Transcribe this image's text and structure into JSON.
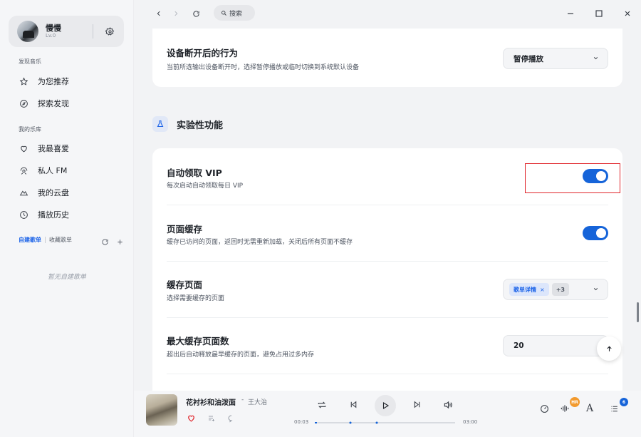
{
  "sidebar": {
    "user": {
      "name": "慢慢",
      "level": "Lv.0"
    },
    "discover_label": "发现音乐",
    "discover_items": [
      {
        "label": "为您推荐",
        "icon": "star-icon"
      },
      {
        "label": "探索发现",
        "icon": "compass-icon"
      }
    ],
    "library_label": "我的乐库",
    "library_items": [
      {
        "label": "我最喜爱",
        "icon": "heart-icon"
      },
      {
        "label": "私人 FM",
        "icon": "radio-icon"
      },
      {
        "label": "我的云盘",
        "icon": "cloud-icon"
      },
      {
        "label": "播放历史",
        "icon": "clock-icon"
      }
    ],
    "playlist_tabs": {
      "created": "自建歌单",
      "collected": "收藏歌单"
    },
    "empty_playlists": "暂无自建歌单"
  },
  "topbar": {
    "search_placeholder": "搜索"
  },
  "settings": {
    "disconnect": {
      "title": "设备断开后的行为",
      "desc": "当前所选输出设备断开时，选择暂停播放或临时切换到系统默认设备",
      "value": "暂停播放"
    },
    "section_title": "实验性功能",
    "auto_vip": {
      "title": "自动领取 VIP",
      "desc": "每次启动自动领取每日 VIP",
      "enabled": true
    },
    "page_cache": {
      "title": "页面缓存",
      "desc": "缓存已访问的页面，返回时无需重新加载，关闭后所有页面不缓存",
      "enabled": true
    },
    "cache_pages": {
      "title": "缓存页面",
      "desc": "选择需要缓存的页面",
      "chip": "歌单详情",
      "more": "+3"
    },
    "max_cache": {
      "title": "最大缓存页面数",
      "desc": "超出后自动释放最早缓存的页面，避免占用过多内存",
      "value": "20"
    }
  },
  "player": {
    "title": "花衬衫和油泼面",
    "separator": "-",
    "artist": "王大治",
    "current_time": "00:03",
    "total_time": "03:00",
    "progress": 0.017,
    "quality_badge": "HR",
    "queue_count": "6"
  },
  "colors": {
    "accent": "#1664d9",
    "highlight": "#e0252b",
    "badge_orange": "#f29a2e"
  }
}
